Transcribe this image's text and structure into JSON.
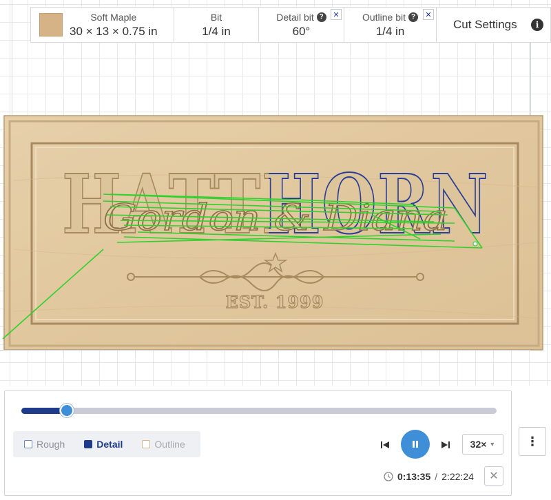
{
  "toolbar": {
    "material": {
      "name": "Soft Maple",
      "dimensions": "30 × 13 × 0.75 in",
      "swatch_color": "#d6b386"
    },
    "bit": {
      "label": "Bit",
      "value": "1/4 in"
    },
    "detail_bit": {
      "label": "Detail bit",
      "value": "60°",
      "help_icon": "question-circle-icon",
      "close_icon": "close-icon"
    },
    "outline_bit": {
      "label": "Outline bit",
      "value": "1/4 in",
      "help_icon": "question-circle-icon",
      "close_icon": "close-icon"
    },
    "cut_settings": {
      "label": "Cut Settings",
      "info_icon": "info-circle-icon"
    }
  },
  "design": {
    "surname": "HATTHORN",
    "names": "Gordon & Diana",
    "established": "EST. 1999",
    "ornament_icon": "star-icon",
    "wood_color": "#e3cba3",
    "toolpath_color": "#2fd12f",
    "outline_path_color": "#2a3f9a"
  },
  "simulation": {
    "progress": 0.095,
    "passes": [
      {
        "label": "Rough",
        "state": "inactive"
      },
      {
        "label": "Detail",
        "state": "active"
      },
      {
        "label": "Outline",
        "state": "inactive"
      }
    ],
    "speed": "32×",
    "current_time": "0:13:35",
    "separator": "/",
    "total_time": "2:22:24",
    "accent_color": "#3f8ed8",
    "active_color": "#1f3b8a"
  },
  "menu": {
    "icon": "more-vertical-icon"
  }
}
